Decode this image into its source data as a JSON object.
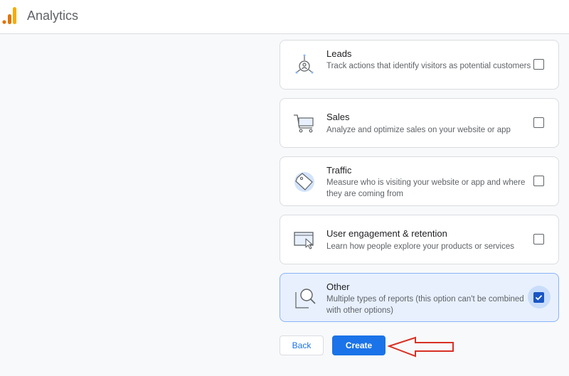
{
  "header": {
    "app_title": "Analytics"
  },
  "objectives": [
    {
      "title": "Leads",
      "description": "Track actions that identify visitors as potential customers",
      "checked": false
    },
    {
      "title": "Sales",
      "description": "Analyze and optimize sales on your website or app",
      "checked": false
    },
    {
      "title": "Traffic",
      "description": "Measure who is visiting your website or app and where they are coming from",
      "checked": false
    },
    {
      "title": "User engagement & retention",
      "description": "Learn how people explore your products or services",
      "checked": false
    },
    {
      "title": "Other",
      "description": "Multiple types of reports (this option can't be combined with other options)",
      "checked": true
    }
  ],
  "actions": {
    "back_label": "Back",
    "create_label": "Create"
  },
  "colors": {
    "accent": "#1a73e8",
    "selected_card_bg": "#e8f0fe",
    "annotation_arrow": "#d93025",
    "logo_orange": "#f9ab00",
    "logo_dark_orange": "#e37400"
  }
}
